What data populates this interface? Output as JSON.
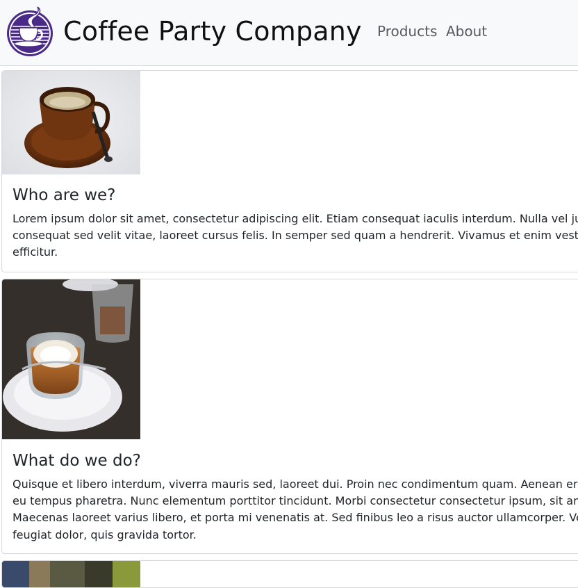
{
  "navbar": {
    "brand": "Coffee Party Company",
    "links": [
      {
        "label": "Products"
      },
      {
        "label": "About"
      }
    ],
    "logo_icon": "coffee-cup-logo-icon"
  },
  "cards": [
    {
      "image_icon": "espresso-cup-photo",
      "title": "Who are we?",
      "text_lines": [
        "Lorem ipsum dolor sit amet, consectetur adipiscing elit. Etiam consequat iaculis interdum. Nulla vel justo nur",
        "consequat sed velit vitae, laoreet cursus felis. In semper sed quam a hendrerit. Vivamus et enim vestibulum,",
        "efficitur."
      ]
    },
    {
      "image_icon": "cortado-glass-photo",
      "title": "What do we do?",
      "text_lines": [
        "Quisque et libero interdum, viverra mauris sed, laoreet dui. Proin nec condimentum quam. Aenean eros ipsu",
        "eu tempus pharetra. Nunc elementum porttitor tincidunt. Morbi consectetur consectetur ipsum, sit amet elei",
        "Maecenas laoreet varius libero, et porta mi venenatis at. Sed finibus leo a risus auctor ullamcorper. Vestibulur",
        "feugiat dolor, quis gravida tortor."
      ]
    },
    {
      "image_icon": "coffee-shop-photo"
    }
  ],
  "colors": {
    "navbar_bg": "#f8f9fa",
    "logo_purple": "#4a2a86",
    "text": "#212529",
    "nav_link": "#555a60"
  }
}
